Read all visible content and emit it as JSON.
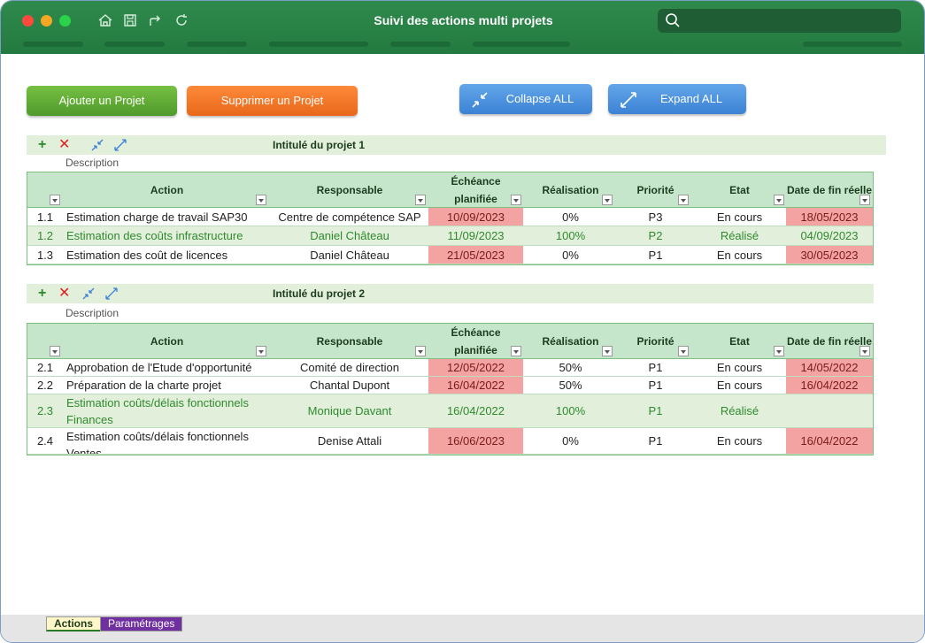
{
  "window": {
    "title": "Suivi des actions multi projets"
  },
  "toolbar": {
    "icons": [
      "home-icon",
      "save-icon",
      "share-icon",
      "refresh-icon"
    ]
  },
  "buttons": {
    "add_project": "Ajouter un Projet",
    "remove_project": "Supprimer un Projet",
    "collapse_all": "Collapse ALL",
    "expand_all": "Expand ALL"
  },
  "columns": [
    "Action",
    "Responsable",
    "Échéance planifiée",
    "Réalisation",
    "Priorité",
    "Etat",
    "Date de fin réelle"
  ],
  "projects": [
    {
      "title": "Intitulé du projet 1",
      "description": "Description",
      "rows": [
        {
          "num": "1.1",
          "action": "Estimation charge de travail SAP30",
          "resp": "Centre de compétence SAP",
          "due": "10/09/2023",
          "done": "0%",
          "prio": "P3",
          "state": "En cours",
          "end": "18/05/2023",
          "due_late": true,
          "end_late": true,
          "completed": false
        },
        {
          "num": "1.2",
          "action": "Estimation des coûts infrastructure",
          "resp": "Daniel Château",
          "due": "11/09/2023",
          "done": "100%",
          "prio": "P2",
          "state": "Réalisé",
          "end": "04/09/2023",
          "due_late": false,
          "end_late": false,
          "completed": true
        },
        {
          "num": "1.3",
          "action": "Estimation des coût de licences",
          "resp": "Daniel Château",
          "due": "21/05/2023",
          "done": "0%",
          "prio": "P1",
          "state": "En cours",
          "end": "30/05/2023",
          "due_late": true,
          "end_late": true,
          "completed": false
        }
      ]
    },
    {
      "title": "Intitulé du projet 2",
      "description": "Description",
      "rows": [
        {
          "num": "2.1",
          "action": "Approbation de l'Etude d'opportunité",
          "resp": "Comité de direction",
          "due": "12/05/2022",
          "done": "50%",
          "prio": "P1",
          "state": "En cours",
          "end": "14/05/2022",
          "due_late": true,
          "end_late": true,
          "completed": false
        },
        {
          "num": "2.2",
          "action": "Préparation de la charte projet",
          "resp": "Chantal Dupont",
          "due": "16/04/2022",
          "done": "50%",
          "prio": "P1",
          "state": "En cours",
          "end": "16/04/2022",
          "due_late": true,
          "end_late": true,
          "completed": false
        },
        {
          "num": "2.3",
          "action": "Estimation coûts/délais fonctionnels Finances",
          "resp": "Monique Davant",
          "due": "16/04/2022",
          "done": "100%",
          "prio": "P1",
          "state": "Réalisé",
          "end": "",
          "due_late": false,
          "end_late": false,
          "completed": true
        },
        {
          "num": "2.4",
          "action": "Estimation coûts/délais fonctionnels Ventes",
          "resp": "Denise Attali",
          "due": "16/06/2023",
          "done": "0%",
          "prio": "P1",
          "state": "En cours",
          "end": "16/04/2022",
          "due_late": true,
          "end_late": true,
          "completed": false
        }
      ]
    }
  ],
  "sheets": {
    "active": "Actions",
    "other": "Paramétrages"
  },
  "colors": {
    "accent": "#237a40",
    "late": "#f4a3a3",
    "done_row": "#e2efda",
    "header": "#c6e6cc"
  }
}
